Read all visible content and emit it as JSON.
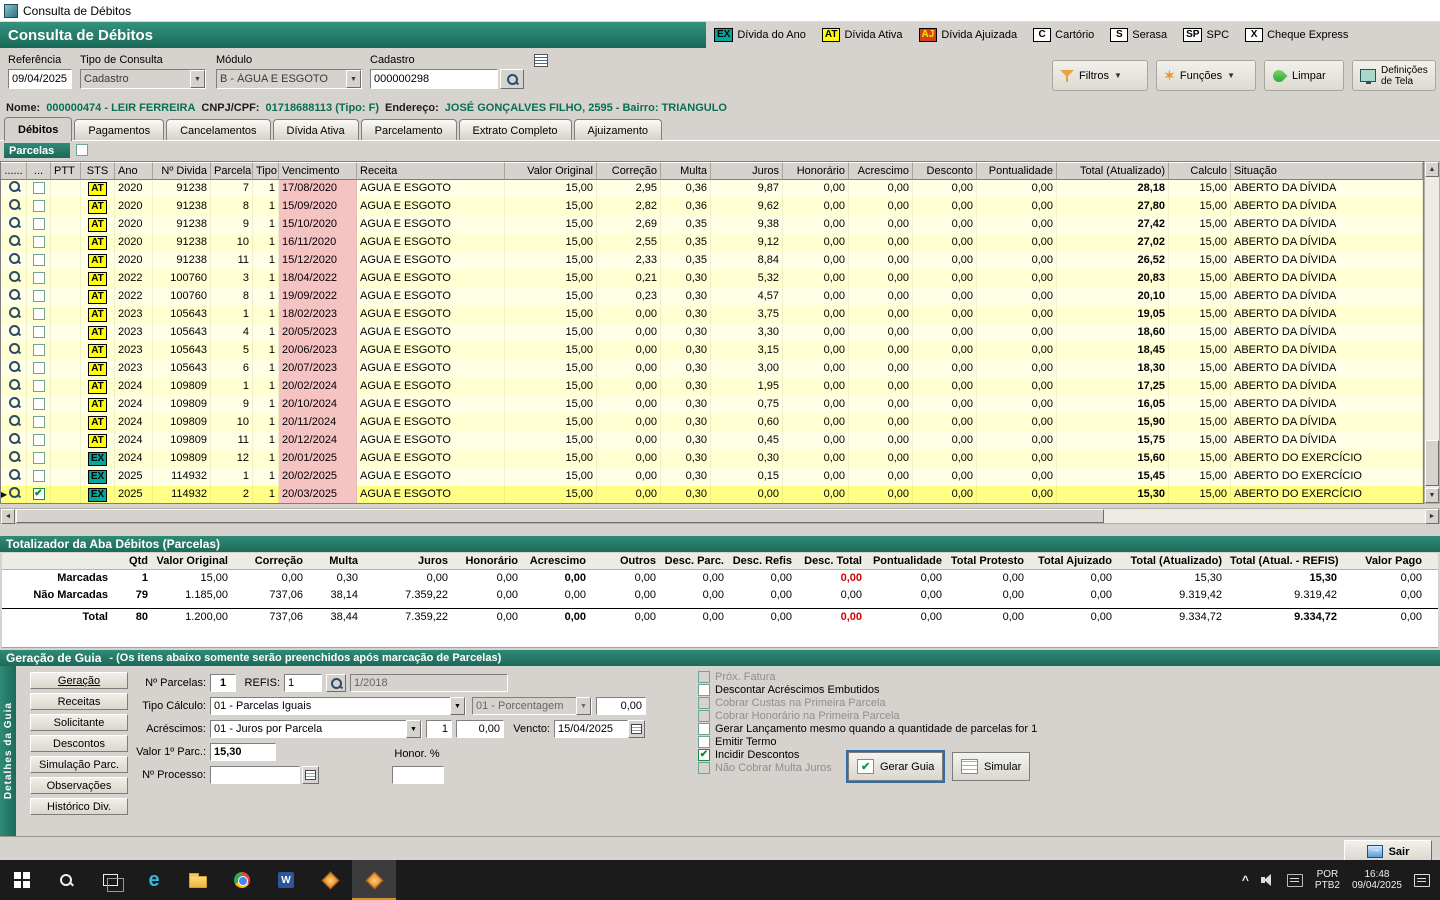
{
  "window": {
    "title": "Consulta de Débitos"
  },
  "header": {
    "title": "Consulta de Débitos"
  },
  "legend": [
    {
      "code": "EX",
      "label": "Dívida do Ano",
      "bg": "#00a99d",
      "fg": "#000000"
    },
    {
      "code": "AT",
      "label": "Dívida Ativa",
      "bg": "#ffff00",
      "fg": "#000000"
    },
    {
      "code": "AJ",
      "label": "Dívida Ajuizada",
      "bg": "#d3421e",
      "fg": "#ffe400"
    },
    {
      "code": "C",
      "label": "Cartório",
      "bg": "#ffffff",
      "fg": "#000000"
    },
    {
      "code": "S",
      "label": "Serasa",
      "bg": "#ffffff",
      "fg": "#000000"
    },
    {
      "code": "SP",
      "label": "SPC",
      "bg": "#ffffff",
      "fg": "#000000"
    },
    {
      "code": "X",
      "label": "Cheque Express",
      "bg": "#ffffff",
      "fg": "#000000"
    }
  ],
  "filters": {
    "referencia_label": "Referência",
    "referencia": "09/04/2025",
    "tipo_label": "Tipo de Consulta",
    "tipo": "Cadastro",
    "modulo_label": "Módulo",
    "modulo": "B - ÁGUA E ESGOTO",
    "cadastro_label": "Cadastro",
    "cadastro": "000000298"
  },
  "toolbar": {
    "filtros": "Filtros",
    "funcoes": "Funções",
    "limpar": "Limpar",
    "definicoes_line1": "Definições",
    "definicoes_line2": "de Tela"
  },
  "customer": {
    "nome_label": "Nome:",
    "nome": "000000474 - LEIR FERREIRA",
    "cnpj_label": "CNPJ/CPF:",
    "cnpj": "01718688113 (Tipo: F)",
    "endereco_label": "Endereço:",
    "endereco": "JOSÉ GONÇALVES FILHO, 2595 - Bairro: TRIANGULO"
  },
  "tabs": [
    "Débitos",
    "Pagamentos",
    "Cancelamentos",
    "Dívida Ativa",
    "Parcelamento",
    "Extrato Completo",
    "Ajuizamento"
  ],
  "active_tab": "Débitos",
  "parcelas_label": "Parcelas",
  "grid": {
    "columns": [
      "......",
      "...",
      "PTT",
      "STS",
      "Ano",
      "Nº Divida",
      "Parcela",
      "Tipo",
      "Vencimento",
      "Receita",
      "Valor Original",
      "Correção",
      "Multa",
      "Juros",
      "Honorário",
      "Acrescimo",
      "Desconto",
      "Pontualidade",
      "Total (Atualizado)",
      "Calculo",
      "Situação"
    ],
    "rows": [
      [
        "AT",
        "2020",
        "91238",
        "7",
        "1",
        "17/08/2020",
        "AGUA E ESGOTO",
        "15,00",
        "2,95",
        "0,36",
        "9,87",
        "0,00",
        "0,00",
        "0,00",
        "0,00",
        "28,18",
        "15,00",
        "ABERTO DA DÍVIDA",
        0
      ],
      [
        "AT",
        "2020",
        "91238",
        "8",
        "1",
        "15/09/2020",
        "AGUA E ESGOTO",
        "15,00",
        "2,82",
        "0,36",
        "9,62",
        "0,00",
        "0,00",
        "0,00",
        "0,00",
        "27,80",
        "15,00",
        "ABERTO DA DÍVIDA",
        0
      ],
      [
        "AT",
        "2020",
        "91238",
        "9",
        "1",
        "15/10/2020",
        "AGUA E ESGOTO",
        "15,00",
        "2,69",
        "0,35",
        "9,38",
        "0,00",
        "0,00",
        "0,00",
        "0,00",
        "27,42",
        "15,00",
        "ABERTO DA DÍVIDA",
        0
      ],
      [
        "AT",
        "2020",
        "91238",
        "10",
        "1",
        "16/11/2020",
        "AGUA E ESGOTO",
        "15,00",
        "2,55",
        "0,35",
        "9,12",
        "0,00",
        "0,00",
        "0,00",
        "0,00",
        "27,02",
        "15,00",
        "ABERTO DA DÍVIDA",
        0
      ],
      [
        "AT",
        "2020",
        "91238",
        "11",
        "1",
        "15/12/2020",
        "AGUA E ESGOTO",
        "15,00",
        "2,33",
        "0,35",
        "8,84",
        "0,00",
        "0,00",
        "0,00",
        "0,00",
        "26,52",
        "15,00",
        "ABERTO DA DÍVIDA",
        0
      ],
      [
        "AT",
        "2022",
        "100760",
        "3",
        "1",
        "18/04/2022",
        "AGUA E ESGOTO",
        "15,00",
        "0,21",
        "0,30",
        "5,32",
        "0,00",
        "0,00",
        "0,00",
        "0,00",
        "20,83",
        "15,00",
        "ABERTO DA DÍVIDA",
        0
      ],
      [
        "AT",
        "2022",
        "100760",
        "8",
        "1",
        "19/09/2022",
        "AGUA E ESGOTO",
        "15,00",
        "0,23",
        "0,30",
        "4,57",
        "0,00",
        "0,00",
        "0,00",
        "0,00",
        "20,10",
        "15,00",
        "ABERTO DA DÍVIDA",
        0
      ],
      [
        "AT",
        "2023",
        "105643",
        "1",
        "1",
        "18/02/2023",
        "AGUA E ESGOTO",
        "15,00",
        "0,00",
        "0,30",
        "3,75",
        "0,00",
        "0,00",
        "0,00",
        "0,00",
        "19,05",
        "15,00",
        "ABERTO DA DÍVIDA",
        0
      ],
      [
        "AT",
        "2023",
        "105643",
        "4",
        "1",
        "20/05/2023",
        "AGUA E ESGOTO",
        "15,00",
        "0,00",
        "0,30",
        "3,30",
        "0,00",
        "0,00",
        "0,00",
        "0,00",
        "18,60",
        "15,00",
        "ABERTO DA DÍVIDA",
        0
      ],
      [
        "AT",
        "2023",
        "105643",
        "5",
        "1",
        "20/06/2023",
        "AGUA E ESGOTO",
        "15,00",
        "0,00",
        "0,30",
        "3,15",
        "0,00",
        "0,00",
        "0,00",
        "0,00",
        "18,45",
        "15,00",
        "ABERTO DA DÍVIDA",
        0
      ],
      [
        "AT",
        "2023",
        "105643",
        "6",
        "1",
        "20/07/2023",
        "AGUA E ESGOTO",
        "15,00",
        "0,00",
        "0,30",
        "3,00",
        "0,00",
        "0,00",
        "0,00",
        "0,00",
        "18,30",
        "15,00",
        "ABERTO DA DÍVIDA",
        0
      ],
      [
        "AT",
        "2024",
        "109809",
        "1",
        "1",
        "20/02/2024",
        "AGUA E ESGOTO",
        "15,00",
        "0,00",
        "0,30",
        "1,95",
        "0,00",
        "0,00",
        "0,00",
        "0,00",
        "17,25",
        "15,00",
        "ABERTO DA DÍVIDA",
        0
      ],
      [
        "AT",
        "2024",
        "109809",
        "9",
        "1",
        "20/10/2024",
        "AGUA E ESGOTO",
        "15,00",
        "0,00",
        "0,30",
        "0,75",
        "0,00",
        "0,00",
        "0,00",
        "0,00",
        "16,05",
        "15,00",
        "ABERTO DA DÍVIDA",
        0
      ],
      [
        "AT",
        "2024",
        "109809",
        "10",
        "1",
        "20/11/2024",
        "AGUA E ESGOTO",
        "15,00",
        "0,00",
        "0,30",
        "0,60",
        "0,00",
        "0,00",
        "0,00",
        "0,00",
        "15,90",
        "15,00",
        "ABERTO DA DÍVIDA",
        0
      ],
      [
        "AT",
        "2024",
        "109809",
        "11",
        "1",
        "20/12/2024",
        "AGUA E ESGOTO",
        "15,00",
        "0,00",
        "0,30",
        "0,45",
        "0,00",
        "0,00",
        "0,00",
        "0,00",
        "15,75",
        "15,00",
        "ABERTO DA DÍVIDA",
        0
      ],
      [
        "EX",
        "2024",
        "109809",
        "12",
        "1",
        "20/01/2025",
        "AGUA E ESGOTO",
        "15,00",
        "0,00",
        "0,30",
        "0,30",
        "0,00",
        "0,00",
        "0,00",
        "0,00",
        "15,60",
        "15,00",
        "ABERTO DO EXERCÍCIO",
        0
      ],
      [
        "EX",
        "2025",
        "114932",
        "1",
        "1",
        "20/02/2025",
        "AGUA E ESGOTO",
        "15,00",
        "0,00",
        "0,30",
        "0,15",
        "0,00",
        "0,00",
        "0,00",
        "0,00",
        "15,45",
        "15,00",
        "ABERTO DO EXERCÍCIO",
        0
      ],
      [
        "EX",
        "2025",
        "114932",
        "2",
        "1",
        "20/03/2025",
        "AGUA E ESGOTO",
        "15,00",
        "0,00",
        "0,30",
        "0,00",
        "0,00",
        "0,00",
        "0,00",
        "0,00",
        "15,30",
        "15,00",
        "ABERTO DO EXERCÍCIO",
        1
      ]
    ]
  },
  "totalizer": {
    "title": "Totalizador da Aba Débitos (Parcelas)",
    "columns": [
      "",
      "Qtd",
      "Valor Original",
      "Correção",
      "Multa",
      "Juros",
      "Honorário",
      "Acrescimo",
      "Outros",
      "Desc. Parc.",
      "Desc. Refis",
      "Desc. Total",
      "Pontualidade",
      "Total Protesto",
      "Total Ajuizado",
      "Total (Atualizado)",
      "Total (Atual. - REFIS)",
      "Valor Pago"
    ],
    "rows": [
      {
        "label": "Marcadas",
        "values": [
          "1",
          "15,00",
          "0,00",
          "0,30",
          "0,00",
          "0,00",
          "0,00",
          "0,00",
          "0,00",
          "0,00",
          "0,00",
          "0,00",
          "0,00",
          "0,00",
          "15,30",
          "15,30",
          "0,00"
        ],
        "bold": [
          0,
          6,
          15
        ],
        "red": [
          10
        ]
      },
      {
        "label": "Não Marcadas",
        "values": [
          "79",
          "1.185,00",
          "737,06",
          "38,14",
          "7.359,22",
          "0,00",
          "0,00",
          "0,00",
          "0,00",
          "0,00",
          "0,00",
          "0,00",
          "0,00",
          "0,00",
          "9.319,42",
          "9.319,42",
          "0,00"
        ],
        "bold": [
          0
        ],
        "red": []
      },
      {
        "label": "Total",
        "values": [
          "80",
          "1.200,00",
          "737,06",
          "38,44",
          "7.359,22",
          "0,00",
          "0,00",
          "0,00",
          "0,00",
          "0,00",
          "0,00",
          "0,00",
          "0,00",
          "0,00",
          "9.334,72",
          "9.334,72",
          "0,00"
        ],
        "bold": [
          0,
          6,
          15
        ],
        "red": [
          10
        ]
      }
    ]
  },
  "guia": {
    "title": "Geração de Guia",
    "subtitle": "-   (Os itens abaixo somente serão preenchidos após marcação de Parcelas)",
    "sidebar_title": "Detalhes da Guia",
    "sidebar_buttons": [
      "Geração",
      "Receitas",
      "Solicitante",
      "Descontos",
      "Simulação Parc.",
      "Observações",
      "Histórico Div."
    ],
    "fields": {
      "num_parcelas_label": "Nº Parcelas:",
      "num_parcelas": "1",
      "refis_label": "REFIS:",
      "refis": "1",
      "refis_ref": "1/2018",
      "tipo_calculo_label": "Tipo Cálculo:",
      "tipo_calculo": "01 - Parcelas Iguais",
      "porcentagem": "01 - Porcentagem",
      "porcentagem_valor": "0,00",
      "acrescimos_label": "Acréscimos:",
      "acrescimos": "01 - Juros por Parcela",
      "acrescimos_qtd": "1",
      "acrescimos_valor": "0,00",
      "vencto_label": "Vencto:",
      "vencto": "15/04/2025",
      "valor_parc_label": "Valor 1º Parc.:",
      "valor_parc": "15,30",
      "honor_label": "Honor. %",
      "processo_label": "Nº Processo:"
    },
    "checkboxes": [
      {
        "label": "Próx. Fatura",
        "checked": false,
        "disabled": true
      },
      {
        "label": "Descontar Acréscimos Embutidos",
        "checked": false,
        "disabled": false
      },
      {
        "label": "Cobrar Custas na Primeira Parcela",
        "checked": false,
        "disabled": true
      },
      {
        "label": "Cobrar Honorário na Primeira Parcela",
        "checked": false,
        "disabled": true
      },
      {
        "label": "Gerar Lançamento mesmo quando a quantidade de parcelas for 1",
        "checked": false,
        "disabled": false
      },
      {
        "label": "Emitir Termo",
        "checked": false,
        "disabled": false
      },
      {
        "label": "Incidir Descontos",
        "checked": true,
        "disabled": false
      },
      {
        "label": "Não Cobrar Multa Juros",
        "checked": false,
        "disabled": true
      }
    ],
    "buttons": {
      "gerar": "Gerar Guia",
      "simular": "Simular"
    }
  },
  "footer": {
    "sair": "Sair"
  },
  "taskbar": {
    "tray": {
      "chevron": "^",
      "lang_top": "POR",
      "lang_bottom": "PTB2",
      "time": "16:48",
      "date": "09/04/2025"
    }
  }
}
